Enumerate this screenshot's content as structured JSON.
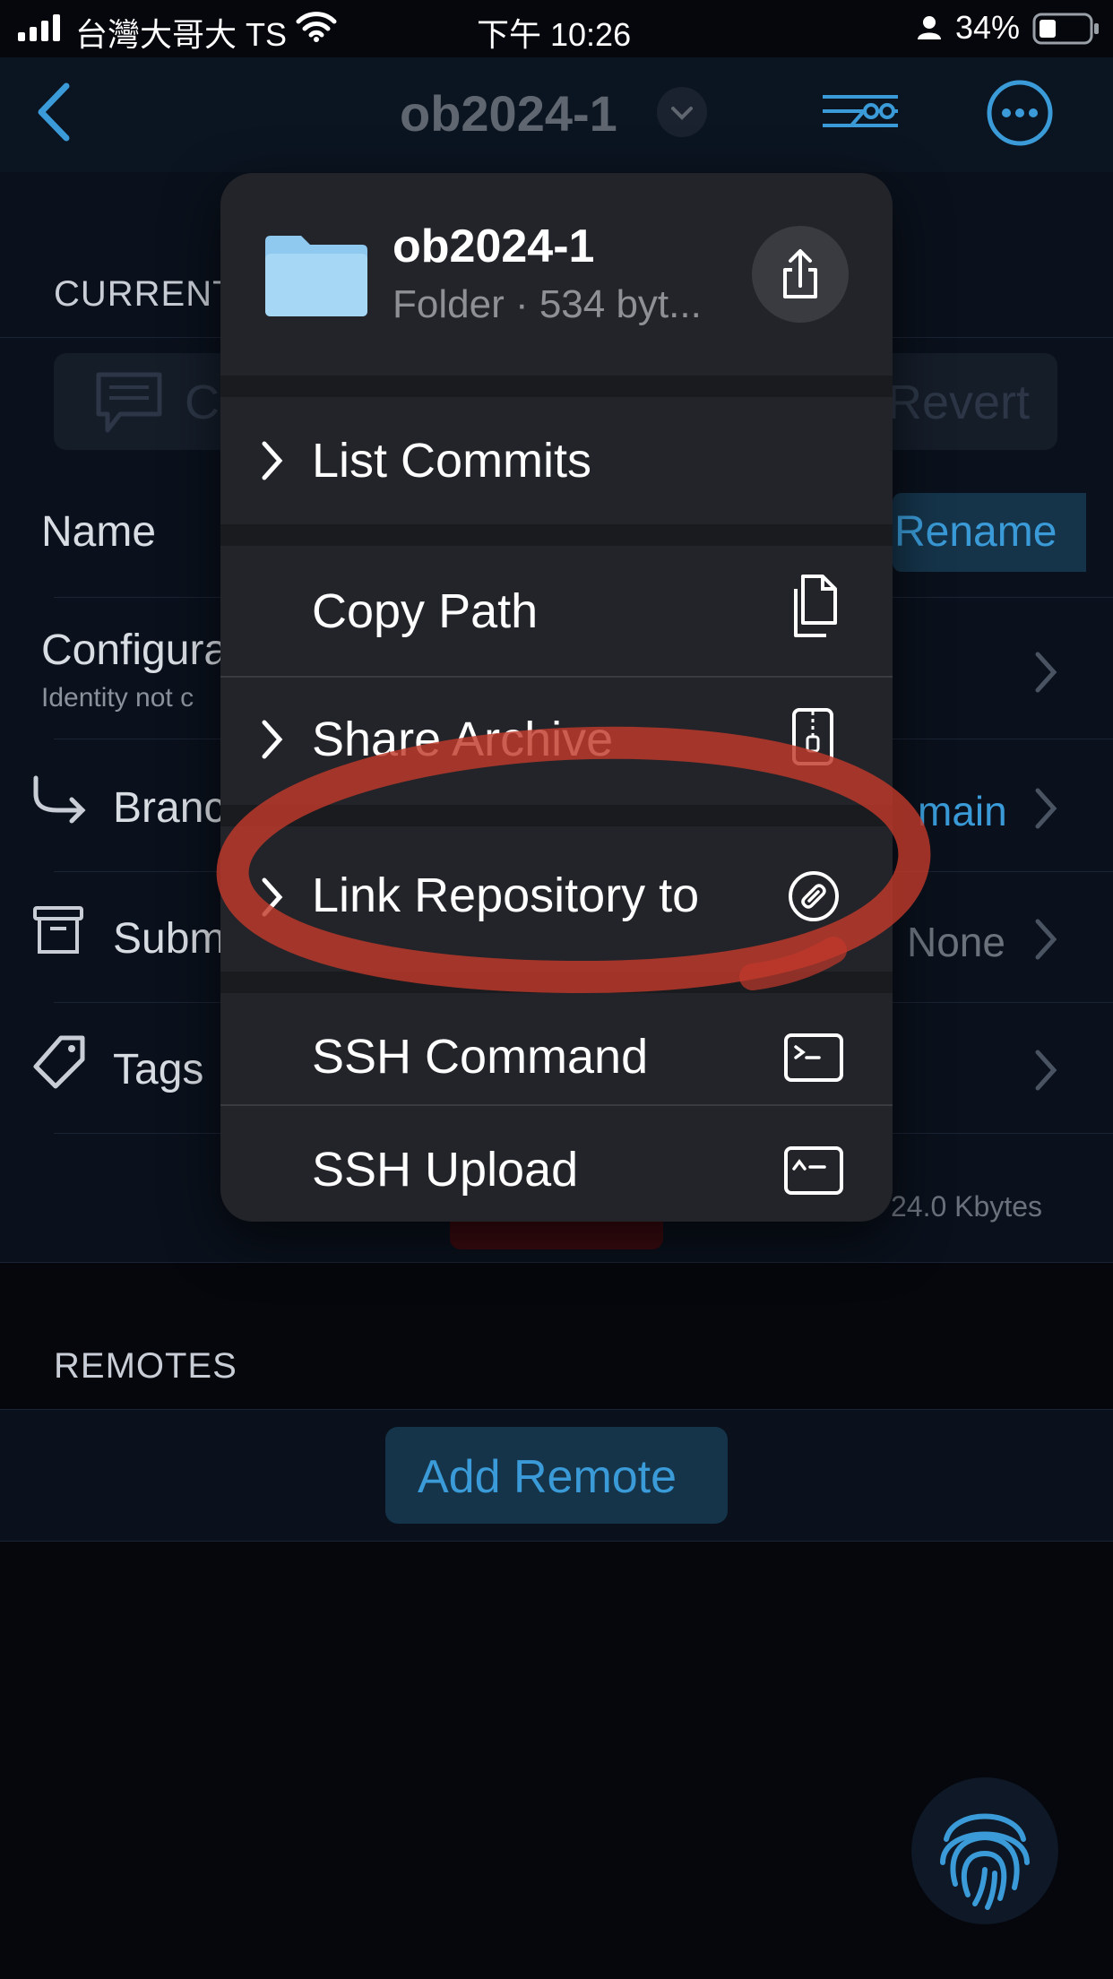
{
  "status_bar": {
    "carrier": "台灣大哥大 TS",
    "time": "下午 10:26",
    "battery": "34%"
  },
  "nav": {
    "title": "ob2024-1"
  },
  "background": {
    "current_section": "CURRENT",
    "commit_placeholder": "C",
    "revert_label": "Revert",
    "name_label": "Name",
    "rename_label": "Rename",
    "configure_label": "Configura",
    "configure_sub": "Identity not c",
    "branch_label": "Branc",
    "branch_value": "main",
    "submodules_label": "Subm",
    "submodules_value": "None",
    "tags_label": "Tags",
    "size_text": "24.0 Kbytes",
    "remotes_section": "REMOTES",
    "add_remote_label": "Add Remote"
  },
  "menu": {
    "header_title": "ob2024-1",
    "header_subtitle": "Folder · 534 byt...",
    "items": [
      {
        "label": "List Commits",
        "has_chevron": true,
        "icon": "none"
      },
      {
        "label": "Copy Path",
        "has_chevron": false,
        "icon": "copy-icon"
      },
      {
        "label": "Share Archive",
        "has_chevron": true,
        "icon": "zip-icon"
      },
      {
        "label": "Link Repository to",
        "has_chevron": true,
        "icon": "link-icon"
      },
      {
        "label": "SSH Command",
        "has_chevron": false,
        "icon": "terminal-icon"
      },
      {
        "label": "SSH Upload",
        "has_chevron": false,
        "icon": "terminal-upload-icon"
      }
    ]
  },
  "colors": {
    "accent": "#3a9bd8",
    "menu_bg": "#232429",
    "annotation": "#c0392b"
  }
}
